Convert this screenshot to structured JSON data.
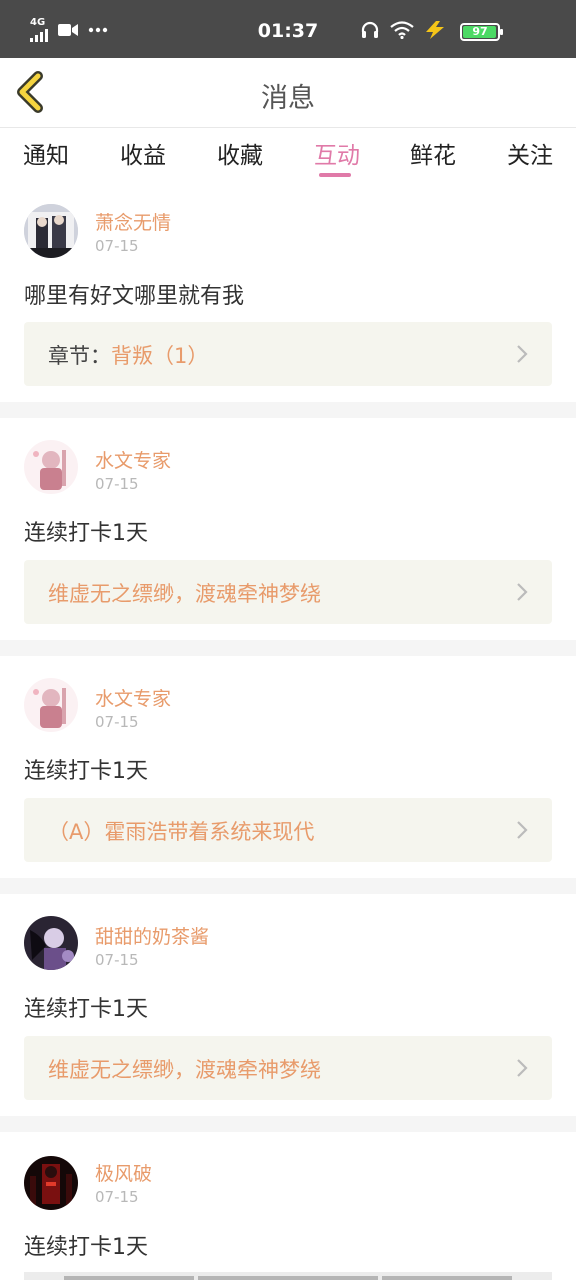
{
  "status_bar": {
    "network": "4G",
    "time": "01:37",
    "battery": "97",
    "battery_level": 0.97
  },
  "header": {
    "title": "消息"
  },
  "tabs": [
    {
      "label": "通知"
    },
    {
      "label": "收益"
    },
    {
      "label": "收藏"
    },
    {
      "label": "互动",
      "active": true
    },
    {
      "label": "鲜花"
    },
    {
      "label": "关注"
    }
  ],
  "messages": [
    {
      "user": "萧念无情",
      "date": "07-15",
      "text": "哪里有好文哪里就有我",
      "ref_prefix": "章节：",
      "ref_title": "背叛（1）"
    },
    {
      "user": "水文专家",
      "date": "07-15",
      "text": "连续打卡1天",
      "ref_prefix": "",
      "ref_title": "维虚无之缥缈，渡魂牵神梦绕"
    },
    {
      "user": "水文专家",
      "date": "07-15",
      "text": "连续打卡1天",
      "ref_prefix": "",
      "ref_title": "（A）霍雨浩带着系统来现代"
    },
    {
      "user": "甜甜的奶茶酱",
      "date": "07-15",
      "text": "连续打卡1天",
      "ref_prefix": "",
      "ref_title": "维虚无之缥缈，渡魂牵神梦绕"
    },
    {
      "user": "极风破",
      "date": "07-15",
      "text": "连续打卡1天"
    }
  ],
  "colors": {
    "accent": "#e07aa8",
    "username": "#e89b6b",
    "ref_bg": "#f5f5ee",
    "statusbar_bg": "#4a4a4a"
  },
  "icons": {
    "back": "back-chevron-icon",
    "chevron": "chevron-right-icon",
    "headphones": "headphones-icon",
    "wifi": "wifi-icon",
    "charging": "charging-bolt-icon",
    "video": "video-camera-icon"
  }
}
